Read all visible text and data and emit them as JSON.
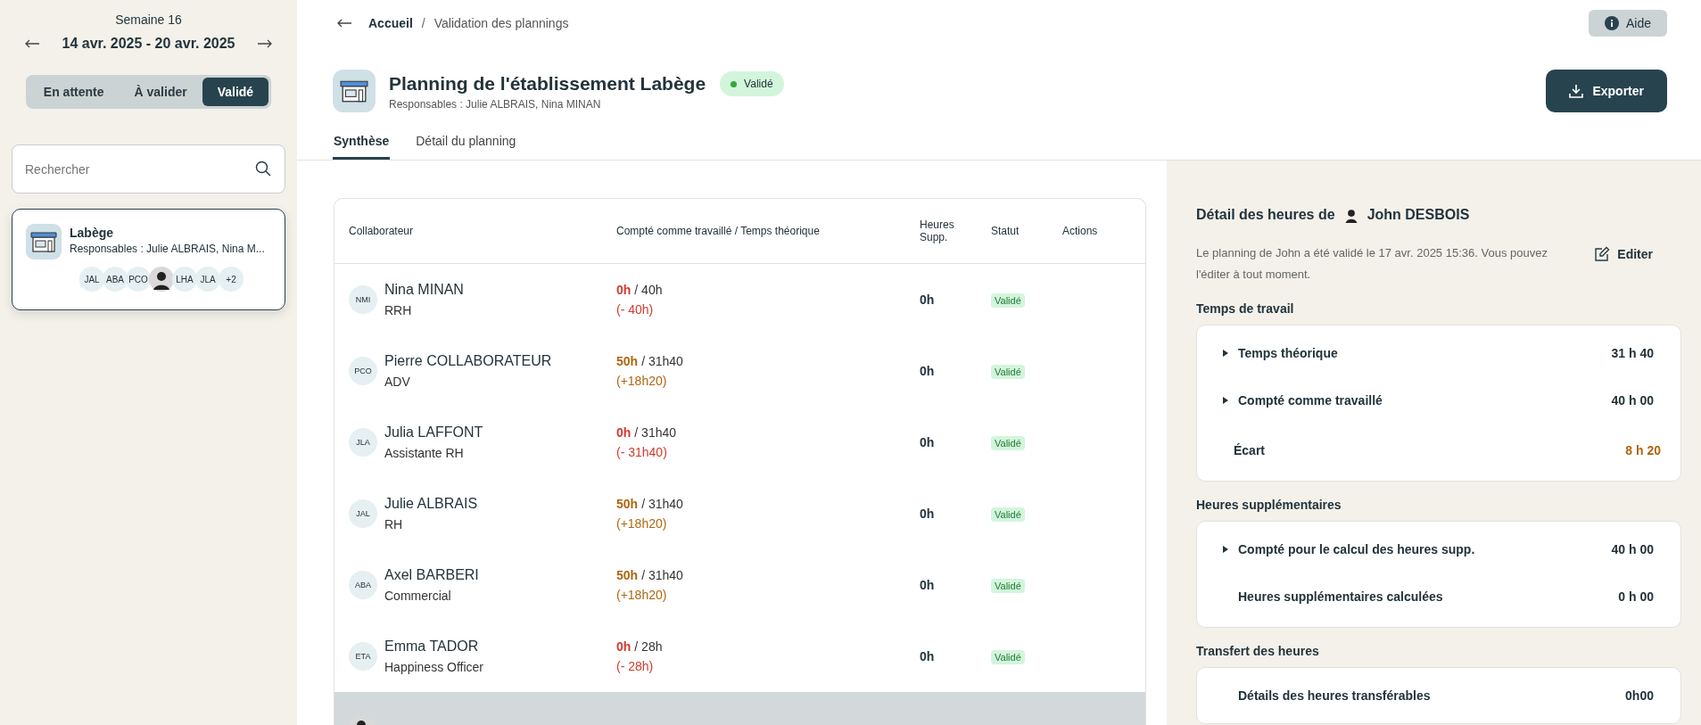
{
  "sidebar": {
    "week": "Semaine 16",
    "date_range": "14 avr. 2025 - 20 avr. 2025",
    "filters": [
      {
        "label": "En attente",
        "selected": false
      },
      {
        "label": "À valider",
        "selected": false
      },
      {
        "label": "Validé",
        "selected": true
      }
    ],
    "search": {
      "placeholder": "Rechercher"
    },
    "sites": [
      {
        "name": "Labège",
        "managers": "Responsables : Julie ALBRAIS, Nina M...",
        "selected": true,
        "avatars": [
          {
            "kind": "initials",
            "text": "JAL"
          },
          {
            "kind": "initials",
            "text": "ABA"
          },
          {
            "kind": "initials",
            "text": "PCO"
          },
          {
            "kind": "photo"
          },
          {
            "kind": "initials",
            "text": "LHA"
          },
          {
            "kind": "initials",
            "text": "JLA"
          },
          {
            "kind": "initials",
            "text": "+2"
          }
        ]
      }
    ]
  },
  "breadcrumb": [
    {
      "label": "Accueil"
    },
    {
      "label": "Validation des plannings"
    }
  ],
  "breadcrumb_separator": "/",
  "help_button": "Aide",
  "header": {
    "title": "Planning de l'établissement Labège",
    "status": "Validé",
    "managers": "Responsables : Julie ALBRAIS, Nina MINAN"
  },
  "export_button": "Exporter",
  "tabs": [
    {
      "label": "Synthèse",
      "selected": true
    },
    {
      "label": "Détail du planning",
      "selected": false
    }
  ],
  "table": {
    "columns": [
      "Collaborateur",
      "Compté comme travaillé / Temps théorique",
      "Heures Supp.",
      "Statut",
      "Actions"
    ],
    "rows": [
      {
        "avatar": {
          "kind": "initials",
          "text": "NMI"
        },
        "name": "Nina MINAN",
        "role": "RRH",
        "worked": "0h",
        "theoretical": "/ 40h",
        "gap": "(- 40h)",
        "surplus": false,
        "overtime": "0h",
        "status": "Validé",
        "selected": false
      },
      {
        "avatar": {
          "kind": "initials",
          "text": "PCO"
        },
        "name": "Pierre COLLABORATEUR",
        "role": "ADV",
        "worked": "50h",
        "theoretical": "/ 31h40",
        "gap": "(+18h20)",
        "surplus": true,
        "overtime": "0h",
        "status": "Validé",
        "selected": false
      },
      {
        "avatar": {
          "kind": "initials",
          "text": "JLA"
        },
        "name": "Julia LAFFONT",
        "role": "Assistante RH",
        "worked": "0h",
        "theoretical": "/ 31h40",
        "gap": "(- 31h40)",
        "surplus": false,
        "overtime": "0h",
        "status": "Validé",
        "selected": false
      },
      {
        "avatar": {
          "kind": "initials",
          "text": "JAL"
        },
        "name": "Julie ALBRAIS",
        "role": "RH",
        "worked": "50h",
        "theoretical": "/ 31h40",
        "gap": "(+18h20)",
        "surplus": true,
        "overtime": "0h",
        "status": "Validé",
        "selected": false
      },
      {
        "avatar": {
          "kind": "initials",
          "text": "ABA"
        },
        "name": "Axel BARBERI",
        "role": "Commercial",
        "worked": "50h",
        "theoretical": "/ 31h40",
        "gap": "(+18h20)",
        "surplus": true,
        "overtime": "0h",
        "status": "Validé",
        "selected": false
      },
      {
        "avatar": {
          "kind": "initials",
          "text": "ETA"
        },
        "name": "Emma TADOR",
        "role": "Happiness Officer",
        "worked": "0h",
        "theoretical": "/ 28h",
        "gap": "(- 28h)",
        "surplus": false,
        "overtime": "0h",
        "status": "Validé",
        "selected": false
      },
      {
        "avatar": {
          "kind": "photo"
        },
        "selected": true
      }
    ]
  },
  "detail": {
    "title": "Détail des heures de",
    "person": "John DESBOIS",
    "note": "Le planning de John a été validé le 17 avr. 2025 15:36. Vous pouvez l'éditer à tout moment.",
    "edit_button": "Editer",
    "sections": [
      {
        "title": "Temps de travail",
        "rows": [
          {
            "kind": "expandable",
            "label": "Temps théorique",
            "value": "31 h 40",
            "highlight": false
          },
          {
            "kind": "expandable",
            "label": "Compté comme travaillé",
            "value": "40 h 00",
            "highlight": false
          },
          {
            "kind": "plain",
            "label": "Écart",
            "value": "8 h 20",
            "highlight": true
          }
        ]
      },
      {
        "title": "Heures supplémentaires",
        "rows": [
          {
            "kind": "expandable",
            "label": "Compté pour le calcul des heures supp.",
            "value": "40 h 00",
            "highlight": false
          },
          {
            "kind": "plain",
            "label": "Heures supplémentaires calculées",
            "value": "0 h 00",
            "highlight": false
          }
        ]
      },
      {
        "title": "Transfert des heures",
        "rows": [
          {
            "kind": "plain",
            "label": "Détails des heures transférables",
            "value": "0h00",
            "highlight": false
          }
        ]
      }
    ]
  }
}
